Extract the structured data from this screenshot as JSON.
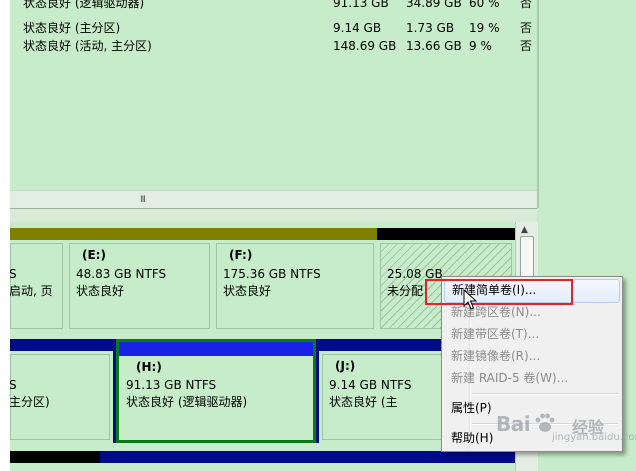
{
  "volume_list": {
    "rows": [
      {
        "status": "状态良好 (逻辑驱动器)",
        "capacity": "91.13 GB",
        "free": "34.89 GB",
        "percent": "60 %",
        "fault_tolerance": "否"
      },
      {
        "status": "状态良好 (主分区)",
        "capacity": "9.14 GB",
        "free": "1.73 GB",
        "percent": "19 %",
        "fault_tolerance": "否"
      },
      {
        "status": "状态良好 (活动, 主分区)",
        "capacity": "148.69 GB",
        "free": "13.66 GB",
        "percent": "9 %",
        "fault_tolerance": "否"
      }
    ],
    "scroll_grip": "III"
  },
  "disk_map": {
    "row1": [
      {
        "line1": "S",
        "line2": "启动, 页"
      },
      {
        "title": "(E:)",
        "size": "48.83 GB NTFS",
        "status": "状态良好"
      },
      {
        "title": "(F:)",
        "size": "175.36 GB NTFS",
        "status": "状态良好"
      },
      {
        "size": "25.08 GB",
        "status": "未分配"
      }
    ],
    "row2": [
      {
        "line1": "S",
        "line2": "主分区)"
      },
      {
        "title": "(H:)",
        "size": "91.13 GB NTFS",
        "status": "状态良好 (逻辑驱动器)"
      },
      {
        "title": "(J:)",
        "size": "9.14 GB NTFS",
        "status": "状态良好 (主"
      }
    ]
  },
  "context_menu": {
    "items": [
      {
        "label": "新建简单卷(I)...",
        "enabled": true,
        "highlighted": true
      },
      {
        "label": "新建跨区卷(N)...",
        "enabled": false
      },
      {
        "label": "新建带区卷(T)...",
        "enabled": false
      },
      {
        "label": "新建镜像卷(R)...",
        "enabled": false
      },
      {
        "label": "新建 RAID-5 卷(W)...",
        "enabled": false
      },
      {
        "label": "属性(P)",
        "enabled": true
      },
      {
        "label": "帮助(H)",
        "enabled": true
      }
    ]
  },
  "watermark": {
    "brand": "Bai",
    "brand_cn": "经验",
    "url": "jingyan.baidu.com"
  },
  "colors": {
    "pane_green": "#c7ecc9",
    "primary_partition_bar": "#817f00",
    "logical_partition_bar": "#1a22e6",
    "extended_bar": "#000b87",
    "unallocated_bar": "#000000",
    "selection_border": "#087a17",
    "callout_red": "#e0242a"
  }
}
